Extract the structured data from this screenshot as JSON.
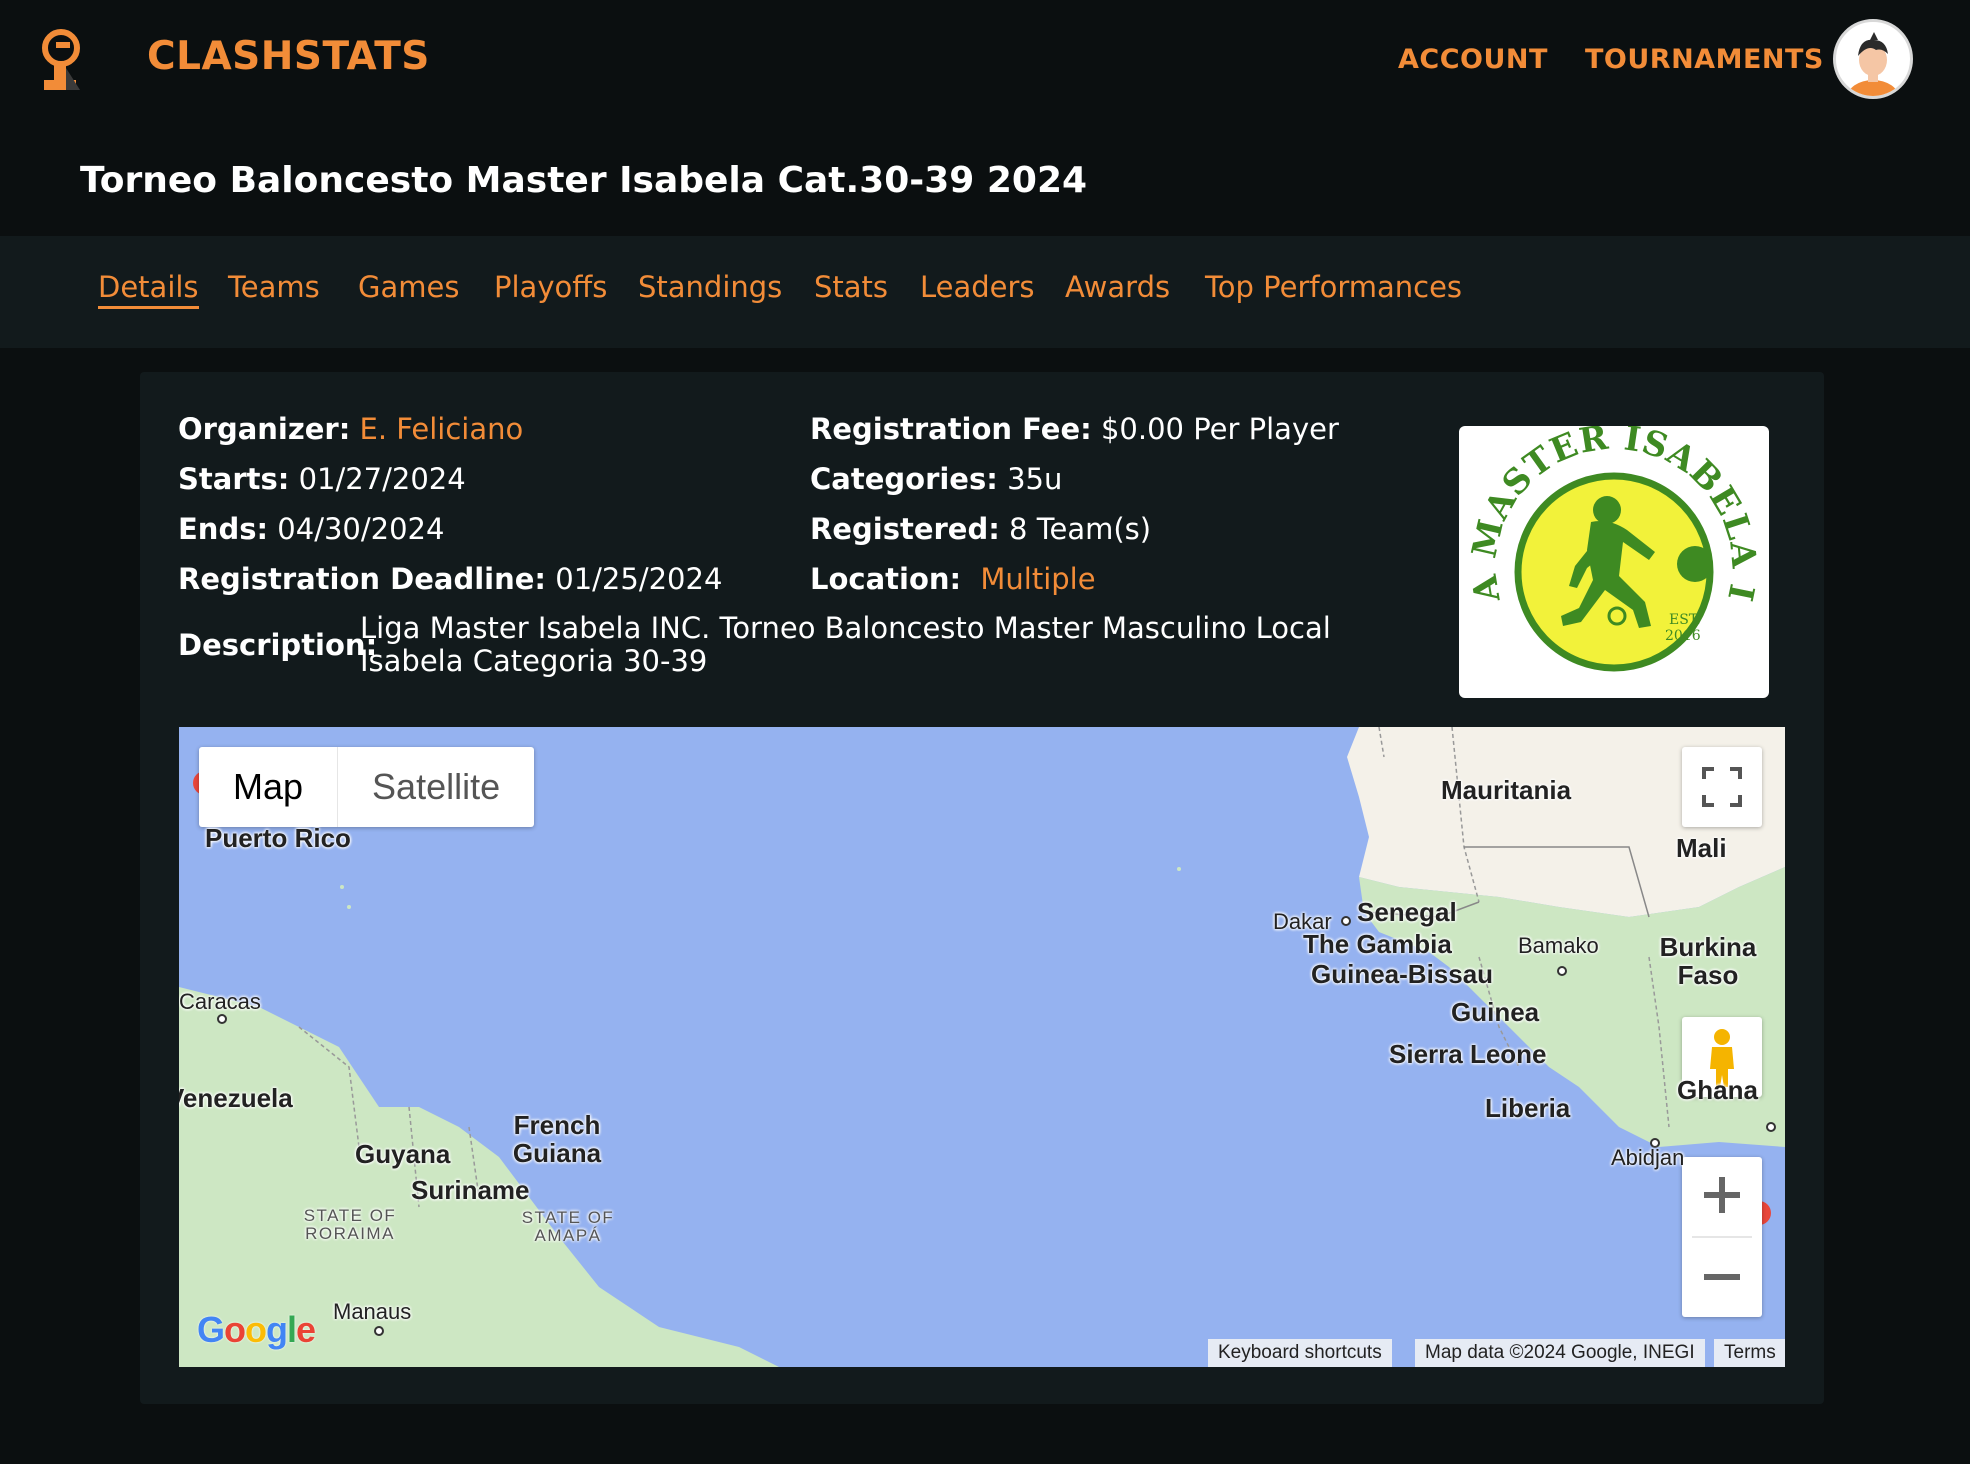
{
  "header": {
    "brand": "CLASHSTATS",
    "nav": {
      "account": "ACCOUNT",
      "tournaments": "TOURNAMENTS"
    }
  },
  "page": {
    "title": "Torneo Baloncesto Master Isabela Cat.30-39 2024"
  },
  "tabs": [
    {
      "label": "Details",
      "active": true
    },
    {
      "label": "Teams"
    },
    {
      "label": "Games"
    },
    {
      "label": "Playoffs"
    },
    {
      "label": "Standings"
    },
    {
      "label": "Stats"
    },
    {
      "label": "Leaders"
    },
    {
      "label": "Awards"
    },
    {
      "label": "Top Performances"
    }
  ],
  "details": {
    "organizer_label": "Organizer:",
    "organizer": "E. Feliciano",
    "starts_label": "Starts:",
    "starts": "01/27/2024",
    "ends_label": "Ends:",
    "ends": "04/30/2024",
    "deadline_label": "Registration Deadline:",
    "deadline": "01/25/2024",
    "fee_label": "Registration Fee:",
    "fee": "$0.00 Per Player",
    "categories_label": "Categories:",
    "categories": "35u",
    "registered_label": "Registered:",
    "registered": "8 Team(s)",
    "location_label": "Location:",
    "location": "Multiple",
    "description_label": "Description:",
    "description": "Liga Master Isabela INC. Torneo Baloncesto Master Masculino Local Isabela Categoria 30-39"
  },
  "org_logo": {
    "text": "LIGA MASTER ISABELA INC.",
    "est": "EST.",
    "year": "2016"
  },
  "map": {
    "type_map": "Map",
    "type_satellite": "Satellite",
    "labels": {
      "puerto_rico": "Puerto Rico",
      "caracas": "Caracas",
      "venezuela": "Venezuela",
      "guyana": "Guyana",
      "suriname": "Suriname",
      "french_guiana": "French Guiana",
      "roraima": "STATE OF RORAIMA",
      "amapa": "STATE OF AMAPÁ",
      "manaus": "Manaus",
      "mauritania": "Mauritania",
      "mali": "Mali",
      "dakar": "Dakar",
      "senegal": "Senegal",
      "gambia": "The Gambia",
      "guinea_bissau": "Guinea-Bissau",
      "bamako": "Bamako",
      "burkina": "Burkina Faso",
      "guinea": "Guinea",
      "sierra_leone": "Sierra Leone",
      "liberia": "Liberia",
      "ghana": "Ghana",
      "abidjan": "Abidjan"
    },
    "attribution": {
      "shortcuts": "Keyboard shortcuts",
      "data": "Map data ©2024 Google, INEGI",
      "terms": "Terms"
    },
    "google_logo": "Google"
  },
  "colors": {
    "accent": "#f28c38",
    "background": "#0b0f10",
    "panel": "#121a1c",
    "water": "#95b2f0",
    "land_green": "#cce8c4",
    "land_desert": "#f5f1e8"
  }
}
